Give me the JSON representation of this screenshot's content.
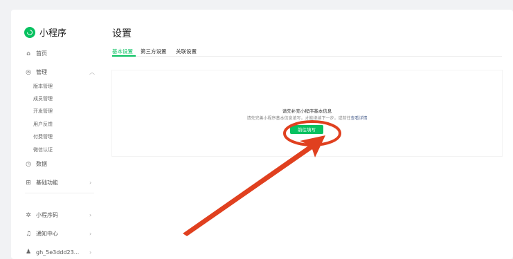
{
  "app": {
    "title": "小程序"
  },
  "sidebar": {
    "home": "首页",
    "manage": "管理",
    "manage_items": [
      "版本管理",
      "成员管理",
      "开发管理",
      "用户反馈",
      "付费管理",
      "微信认证"
    ],
    "data": "数据",
    "basic_features": "基础功能",
    "mini_code": "小程序码",
    "notifications": "通知中心",
    "account": "gh_5e3ddd23..."
  },
  "page": {
    "title": "设置",
    "tabs": [
      "基本设置",
      "第三方设置",
      "关联设置"
    ],
    "active_tab": "基本设置"
  },
  "panel": {
    "title": "请先补充小程序基本信息",
    "desc_prefix": "请先完善小程序基本信息填写，才能继续下一步，或前往",
    "desc_link": "查看详情",
    "button": "前往填写"
  },
  "colors": {
    "brand": "#07c160",
    "annotation": "#e0401f"
  }
}
